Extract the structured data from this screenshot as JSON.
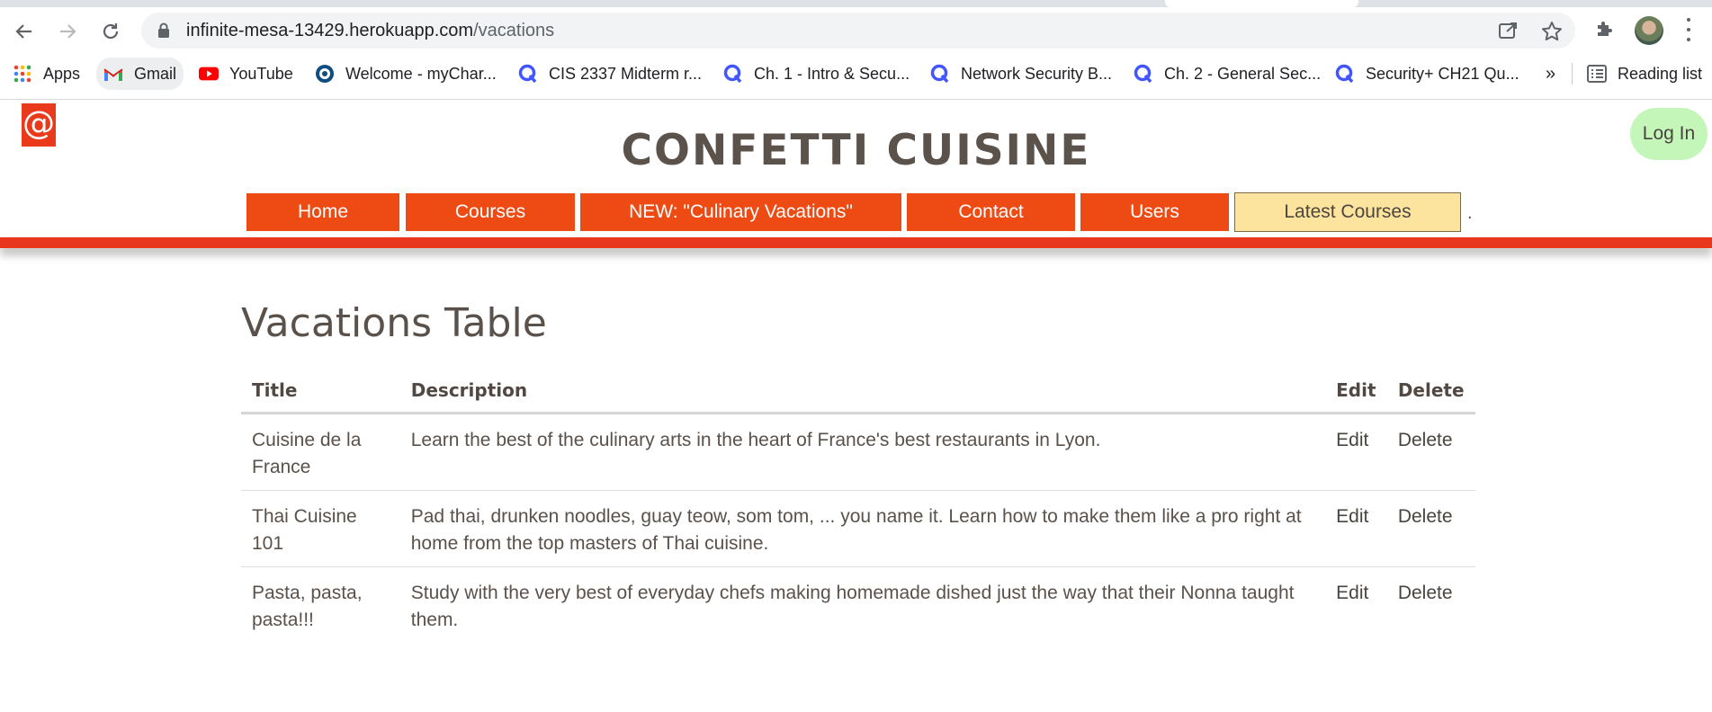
{
  "browser": {
    "url_host": "infinite-mesa-13429.herokuapp.com",
    "url_path": "/vacations",
    "bookmarks": [
      {
        "label": "Apps",
        "icon": "apps-grid-icon"
      },
      {
        "label": "Gmail",
        "icon": "gmail-icon"
      },
      {
        "label": "YouTube",
        "icon": "youtube-icon"
      },
      {
        "label": "Welcome - myChar...",
        "icon": "mychart-icon"
      },
      {
        "label": "CIS 2337 Midterm r...",
        "icon": "quizlet-icon"
      },
      {
        "label": "Ch. 1 - Intro & Secu...",
        "icon": "quizlet-icon"
      },
      {
        "label": "Network Security B...",
        "icon": "quizlet-icon"
      },
      {
        "label": "Ch. 2 - General Sec...",
        "icon": "quizlet-icon"
      },
      {
        "label": "Security+ CH21 Qu...",
        "icon": "quizlet-icon"
      }
    ],
    "overflow": "»",
    "reading_list": "Reading list"
  },
  "site": {
    "logo_symbol": "@",
    "title": "CONFETTI CUISINE",
    "login_label": "Log In",
    "nav": [
      {
        "label": "Home"
      },
      {
        "label": "Courses"
      },
      {
        "label": "NEW: \"Culinary Vacations\""
      },
      {
        "label": "Contact"
      },
      {
        "label": "Users"
      },
      {
        "label": "Latest Courses"
      }
    ],
    "nav_trailing": "."
  },
  "main": {
    "heading": "Vacations Table",
    "columns": [
      "Title",
      "Description",
      "Edit",
      "Delete"
    ],
    "rows": [
      {
        "title": "Cuisine de la France",
        "description": "Learn the best of the culinary arts in the heart of France's best restaurants in Lyon.",
        "edit": "Edit",
        "delete": "Delete"
      },
      {
        "title": "Thai Cuisine 101",
        "description": "Pad thai, drunken noodles, guay teow, som tom, ... you name it. Learn how to make them like a pro right at home from the top masters of Thai cuisine.",
        "edit": "Edit",
        "delete": "Delete"
      },
      {
        "title": "Pasta, pasta, pasta!!!",
        "description": "Study with the very best of everyday chefs making homemade dished just the way that their Nonna taught them.",
        "edit": "Edit",
        "delete": "Delete"
      }
    ]
  },
  "colors": {
    "accent": "#ee4b14",
    "bar": "#e9371d",
    "latest_bg": "#fde49e",
    "login_bg": "#c4f6b9"
  }
}
